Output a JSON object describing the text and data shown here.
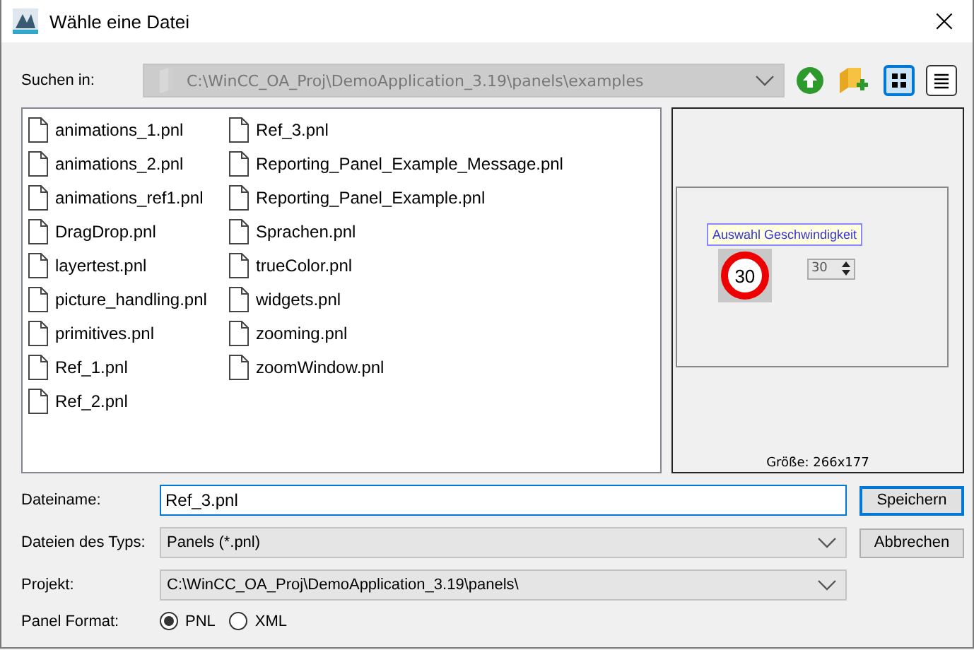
{
  "window": {
    "title": "Wähle eine Datei",
    "close": "×"
  },
  "look_in": {
    "label": "Suchen in:",
    "value": "C:\\WinCC_OA_Proj\\DemoApplication_3.19\\panels\\examples",
    "disabled": true
  },
  "view_buttons": [
    {
      "kind": "icons",
      "selected": true
    },
    {
      "kind": "details",
      "selected": false
    }
  ],
  "files": [
    {
      "name": "animations_1.pnl"
    },
    {
      "name": "animations_2.pnl"
    },
    {
      "name": "animations_ref1.pnl"
    },
    {
      "name": "DragDrop.pnl"
    },
    {
      "name": "layertest.pnl"
    },
    {
      "name": "picture_handling.pnl"
    },
    {
      "name": "primitives.pnl"
    },
    {
      "name": "Ref_1.pnl"
    },
    {
      "name": "Ref_2.pnl"
    },
    {
      "name": "Ref_3.pnl"
    },
    {
      "name": "Reporting_Panel_Example_Message.pnl"
    },
    {
      "name": "Reporting_Panel_Example.pnl"
    },
    {
      "name": "Sprachen.pnl"
    },
    {
      "name": "trueColor.pnl"
    },
    {
      "name": "widgets.pnl"
    },
    {
      "name": "zooming.pnl"
    },
    {
      "name": "zoomWindow.pnl"
    }
  ],
  "preview": {
    "label": "Auswahl Geschwindigkeit",
    "sign": "30",
    "spin_value": "30",
    "size": "Größe: 266x177"
  },
  "filename": {
    "label": "Dateiname:",
    "value": "Ref_3.pnl"
  },
  "filetype": {
    "label": "Dateien des Typs:",
    "value": "Panels (*.pnl)"
  },
  "project": {
    "label": "Projekt:",
    "value": "C:\\WinCC_OA_Proj\\DemoApplication_3.19\\panels\\"
  },
  "format": {
    "label": "Panel Format:",
    "options": [
      {
        "label": "PNL",
        "selected": true
      },
      {
        "label": "XML",
        "selected": false
      }
    ]
  },
  "buttons": [
    {
      "label": "Speichern",
      "default": true
    },
    {
      "label": "Abbrechen",
      "default": false
    }
  ]
}
